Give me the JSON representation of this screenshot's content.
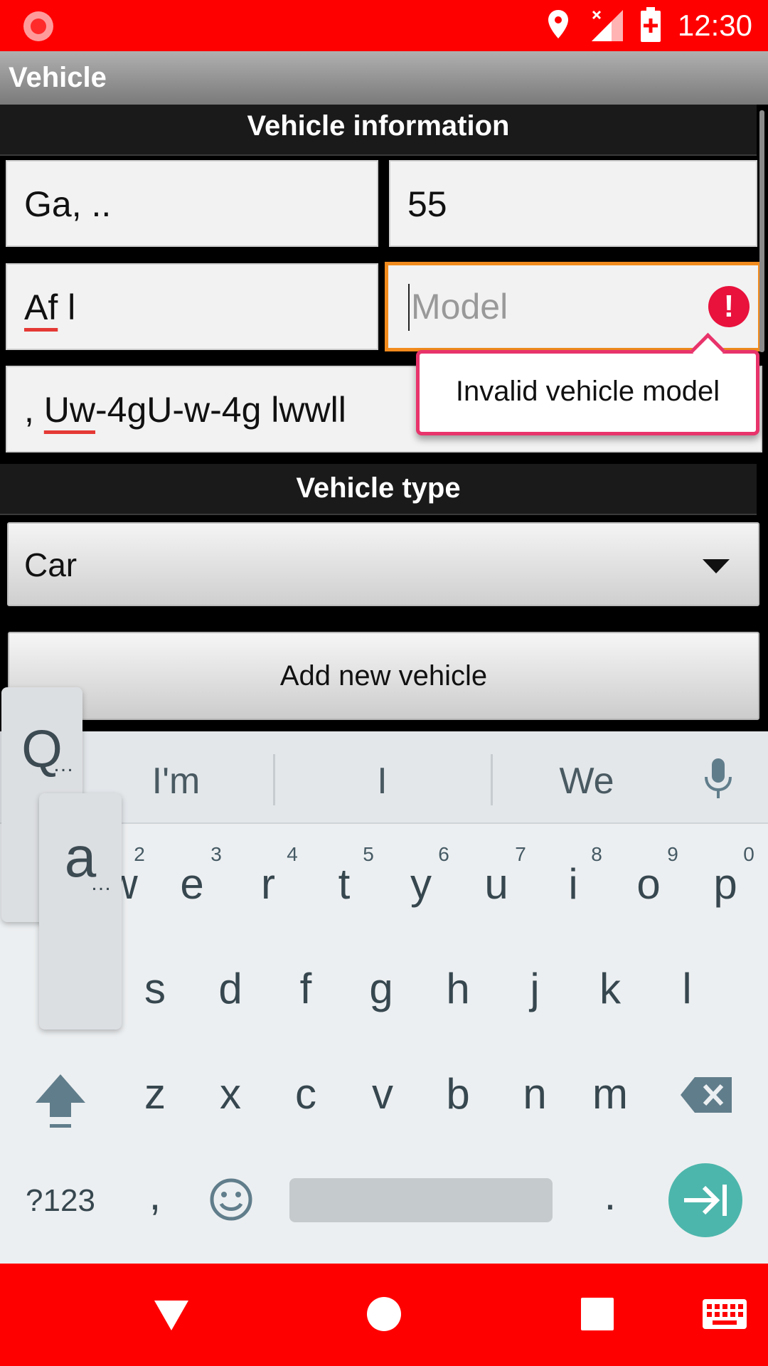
{
  "status_bar": {
    "time": "12:30",
    "icons": [
      "record-icon",
      "location-icon",
      "signal-icon",
      "battery-icon"
    ]
  },
  "app": {
    "title": "Vehicle"
  },
  "form": {
    "section_info": "Vehicle information",
    "field_1": "Ga, ..",
    "field_2": "55",
    "field_3_prefix": "Af",
    "field_3_suffix": " l",
    "model_placeholder": "Model",
    "field_5_prefix": ", ",
    "field_5_underlined": "Uw",
    "field_5_suffix": "-4gU-w-4g lwwll",
    "error_message": "Invalid vehicle model",
    "section_type": "Vehicle type",
    "vehicle_type_selected": "Car",
    "add_button": "Add new vehicle"
  },
  "keyboard": {
    "suggestions": [
      "I'm",
      "I",
      "We"
    ],
    "row1_keys": [
      "w",
      "e",
      "r",
      "t",
      "y",
      "u",
      "i",
      "o",
      "p"
    ],
    "row1_hints": [
      "2",
      "3",
      "4",
      "5",
      "6",
      "7",
      "8",
      "9",
      "0"
    ],
    "row2_keys": [
      "s",
      "d",
      "f",
      "g",
      "h",
      "j",
      "k",
      "l"
    ],
    "row3_keys": [
      "z",
      "x",
      "c",
      "v",
      "b",
      "n",
      "m"
    ],
    "symbols_key": "?123",
    "comma_key": ",",
    "period_key": ".",
    "popup_q": "Q",
    "popup_a": "a",
    "popup_dots": "…",
    "accent_color": "#4db6ac"
  },
  "colors": {
    "status_bar": "#ff0000",
    "error": "#e8123d",
    "focus_border": "#f28b1d"
  }
}
